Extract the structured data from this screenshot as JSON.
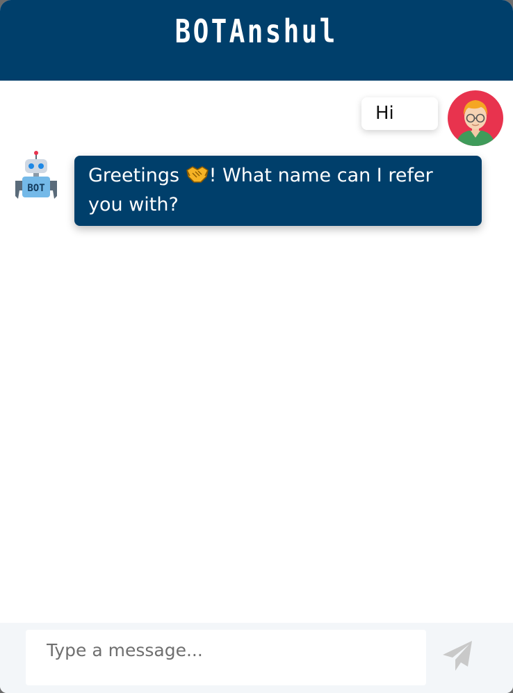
{
  "header": {
    "title": "BOTAnshul",
    "background": "#003f6b"
  },
  "messages": [
    {
      "sender": "user",
      "text": "Hi",
      "avatar_icon": "user-avatar-icon"
    },
    {
      "sender": "bot",
      "text_before_emoji": "Greetings ",
      "emoji_icon": "handshake-icon",
      "text_after_emoji": "! What name can I refer you with?",
      "avatar_icon": "robot-icon",
      "avatar_badge": "BOT"
    }
  ],
  "composer": {
    "placeholder": "Type a message...",
    "value": "",
    "send_icon": "send-icon"
  },
  "colors": {
    "brand": "#003f6b",
    "user_avatar_bg": "#e8334e",
    "send_icon": "#c9c9c9"
  }
}
